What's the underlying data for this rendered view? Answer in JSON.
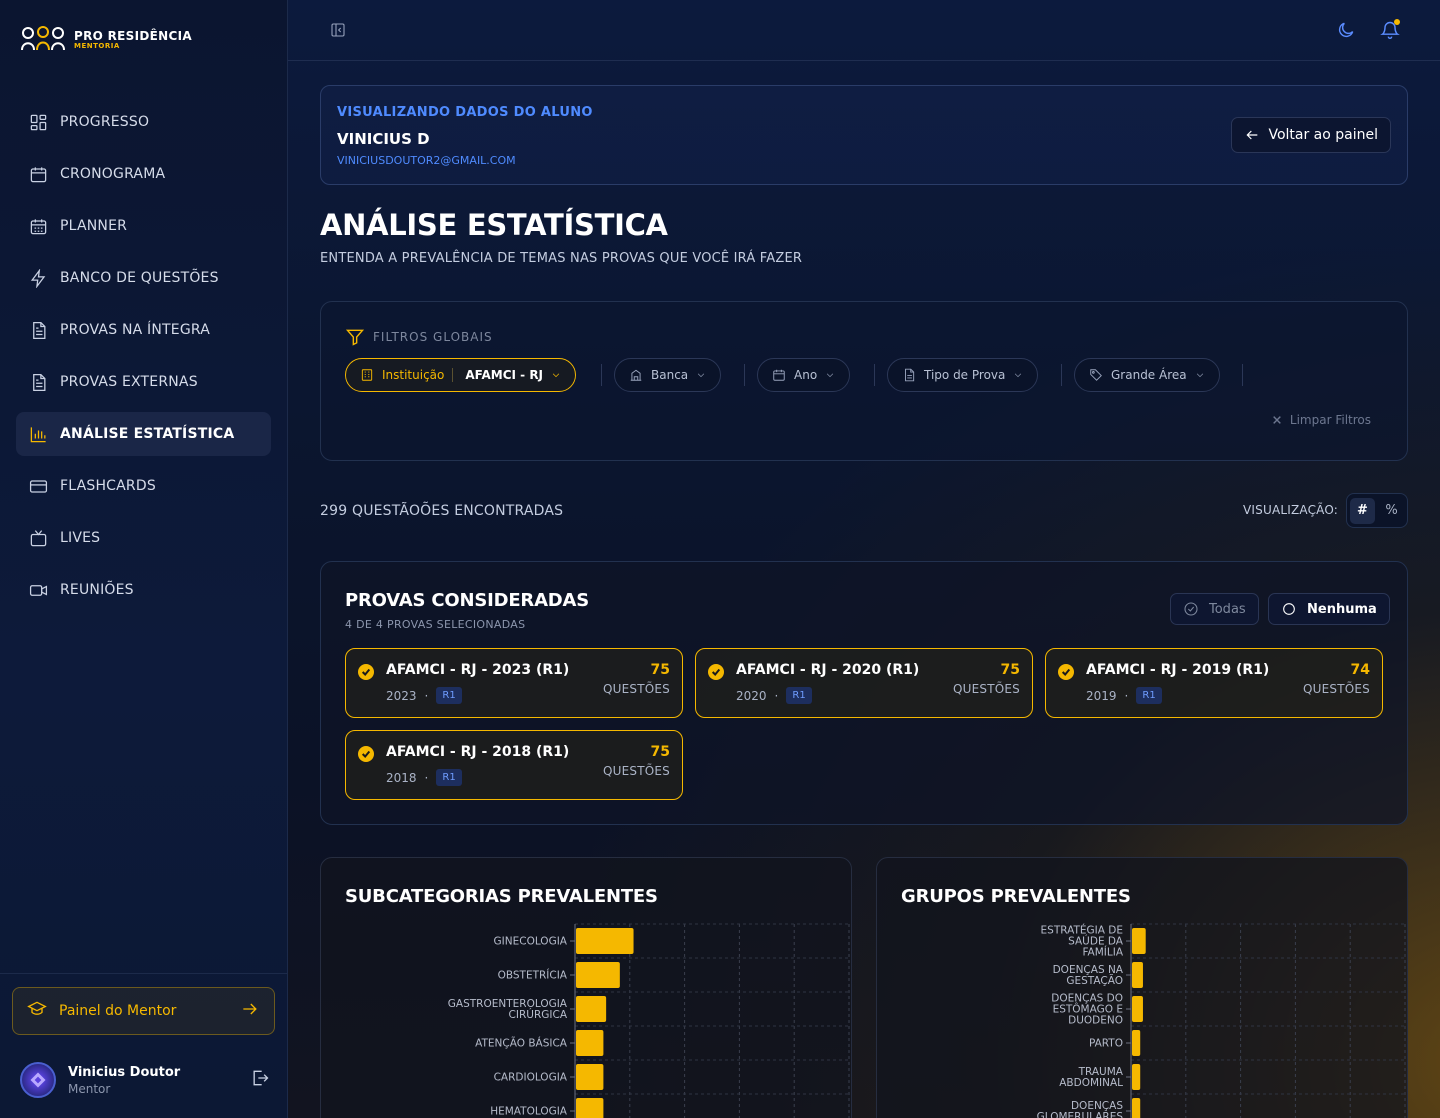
{
  "brand": {
    "name": "PRO RESIDÊNCIA",
    "tagline": "MENTORIA",
    "accent": "#f5b800",
    "link_color": "#4f8bff"
  },
  "nav": [
    {
      "label": "PROGRESSO",
      "icon": "grid-icon"
    },
    {
      "label": "CRONOGRAMA",
      "icon": "calendar-icon"
    },
    {
      "label": "PLANNER",
      "icon": "calendar-grid-icon"
    },
    {
      "label": "BANCO DE QUESTÕES",
      "icon": "lightning-icon"
    },
    {
      "label": "PROVAS NA ÍNTEGRA",
      "icon": "document-icon"
    },
    {
      "label": "PROVAS EXTERNAS",
      "icon": "document-icon"
    },
    {
      "label": "ANÁLISE ESTATÍSTICA",
      "icon": "bar-chart-icon",
      "active": true
    },
    {
      "label": "FLASHCARDS",
      "icon": "card-icon"
    },
    {
      "label": "LIVES",
      "icon": "tv-icon"
    },
    {
      "label": "REUNIÕES",
      "icon": "video-icon"
    }
  ],
  "mentor_button": "Painel do Mentor",
  "user": {
    "name": "Vinicius Doutor",
    "role": "Mentor"
  },
  "student": {
    "label": "VISUALIZANDO DADOS DO ALUNO",
    "name": "VINICIUS D",
    "email": "VINICIUSDOUTOR2@GMAIL.COM",
    "back_label": "Voltar ao painel"
  },
  "page": {
    "title": "ANÁLISE ESTATÍSTICA",
    "subtitle": "ENTENDA A PREVALÊNCIA DE TEMAS NAS PROVAS QUE VOCÊ IRÁ FAZER"
  },
  "filters": {
    "header": "FILTROS GLOBAIS",
    "institution_label": "Instituição",
    "institution_value": "AFAMCI - RJ",
    "banca": "Banca",
    "ano": "Ano",
    "tipo": "Tipo de Prova",
    "area": "Grande Área",
    "clear": "Limpar Filtros"
  },
  "results": {
    "count_text": "299 QUESTÃOÕES ENCONTRADAS",
    "viz_label": "VISUALIZAÇÃO:",
    "viz_options": [
      "#",
      "%"
    ],
    "viz_selected": "#"
  },
  "provas": {
    "title": "PROVAS CONSIDERADAS",
    "subtitle": "4 DE 4 PROVAS SELECIONADAS",
    "all_label": "Todas",
    "none_label": "Nenhuma",
    "questions_label": "QUESTÕES",
    "items": [
      {
        "name": "AFAMCI - RJ - 2023 (R1)",
        "year": "2023",
        "level": "R1",
        "count": "75"
      },
      {
        "name": "AFAMCI - RJ - 2020 (R1)",
        "year": "2020",
        "level": "R1",
        "count": "75"
      },
      {
        "name": "AFAMCI - RJ - 2019 (R1)",
        "year": "2019",
        "level": "R1",
        "count": "74"
      },
      {
        "name": "AFAMCI - RJ - 2018 (R1)",
        "year": "2018",
        "level": "R1",
        "count": "75"
      }
    ]
  },
  "chart_data": [
    {
      "type": "bar",
      "orientation": "horizontal",
      "title": "SUBCATEGORIAS PREVALENTES",
      "categories": [
        "GINECOLOGIA",
        "OBSTETRÍCIA",
        "GASTROENTEROLOGIA CIRÚRGICA",
        "ATENÇÃO BÁSICA",
        "CARDIOLOGIA",
        "HEMATOLOGIA"
      ],
      "values": [
        21,
        16,
        11,
        10,
        10,
        10
      ],
      "xlim": [
        0,
        100
      ],
      "grid": true,
      "bar_color": "#f5b800"
    },
    {
      "type": "bar",
      "orientation": "horizontal",
      "title": "GRUPOS PREVALENTES",
      "categories": [
        "ESTRATÉGIA DE SAÚDE DA FAMÍLIA",
        "DOENÇAS NA GESTAÇÃO",
        "DOENÇAS DO ESTÔMAGO E DUODENO",
        "PARTO",
        "TRAUMA ABDOMINAL",
        "DOENÇAS GLOMERULARES"
      ],
      "values": [
        5,
        4,
        4,
        3,
        3,
        3
      ],
      "xlim": [
        0,
        100
      ],
      "grid": true,
      "bar_color": "#f5b800"
    }
  ]
}
